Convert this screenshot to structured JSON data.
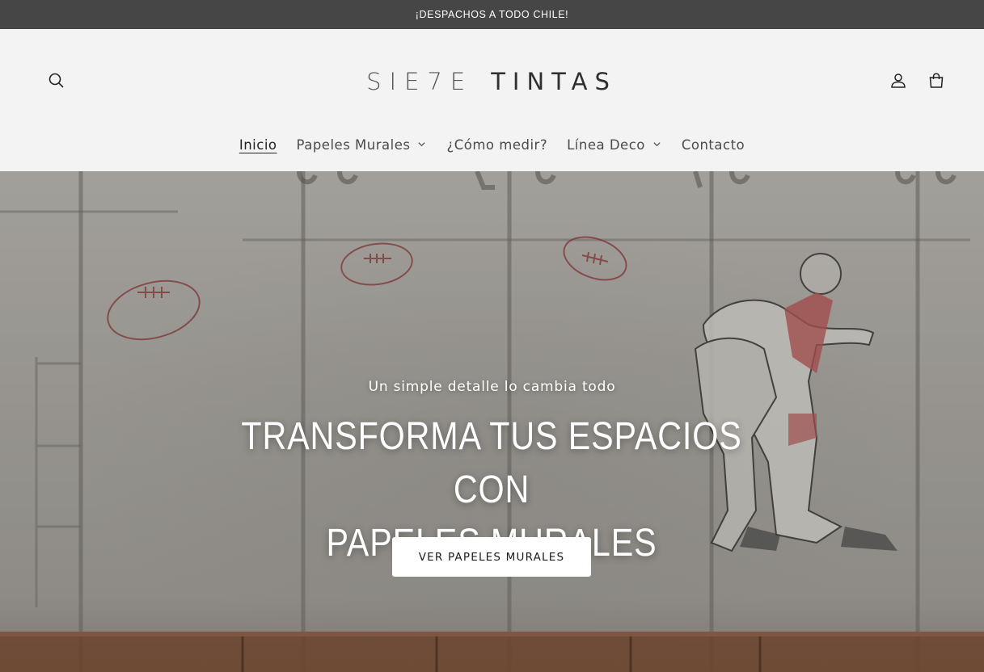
{
  "announcement": {
    "text": "¡DESPACHOS A TODO CHILE!"
  },
  "header": {
    "logo": {
      "word_a": "SIE7E",
      "word_b": "TINTAS"
    },
    "icons": {
      "search": "search-icon",
      "account": "user-icon",
      "cart": "cart-icon"
    }
  },
  "nav": {
    "items": [
      {
        "label": "Inicio",
        "active": true,
        "dropdown": false
      },
      {
        "label": "Papeles Murales",
        "active": false,
        "dropdown": true
      },
      {
        "label": "¿Cómo medir?",
        "active": false,
        "dropdown": false
      },
      {
        "label": "Línea Deco",
        "active": false,
        "dropdown": true
      },
      {
        "label": "Contacto",
        "active": false,
        "dropdown": false
      }
    ]
  },
  "hero": {
    "subtitle": "Un simple detalle lo cambia todo",
    "title_line1": "TRANSFORMA TUS ESPACIOS CON",
    "title_line2": "PAPELES MURALES",
    "cta_label": "VER PAPELES MURALES"
  },
  "colors": {
    "announcement_bg": "#464646",
    "header_bg": "#f3f3f3",
    "accent_red": "#8e3b3b"
  }
}
